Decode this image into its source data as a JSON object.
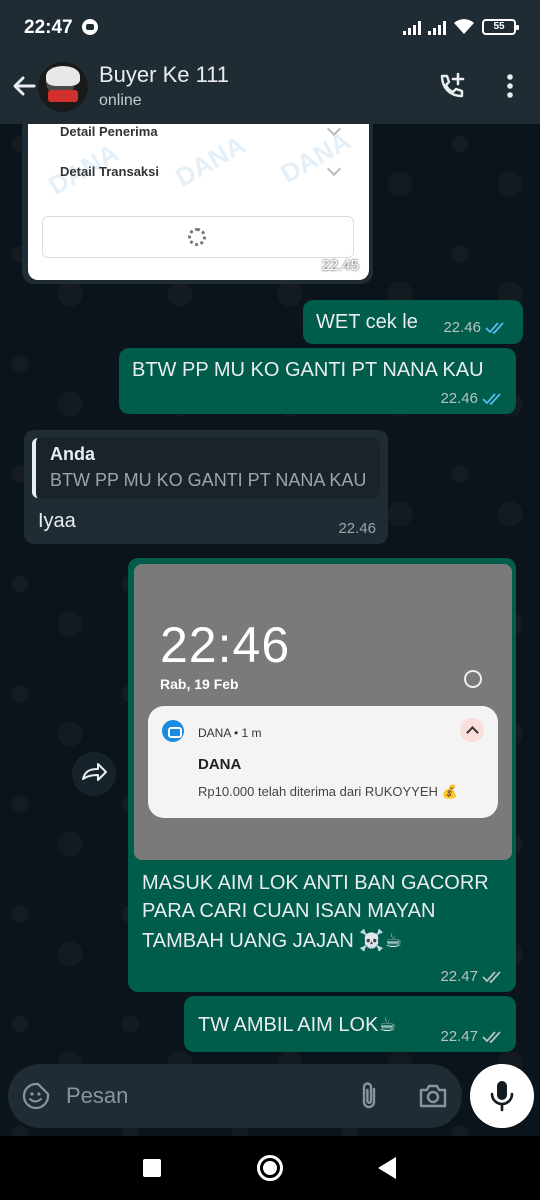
{
  "status_bar": {
    "time": "22:47",
    "battery": "55"
  },
  "header": {
    "name": "Buyer Ke 111",
    "status": "online"
  },
  "image_receipt": {
    "row1": "Detail Penerima",
    "row2": "Detail Transaksi",
    "watermark": "DANA",
    "time": "22.45"
  },
  "messages": {
    "m1": {
      "text": "WET cek le",
      "time": "22.46"
    },
    "m2": {
      "text": "BTW PP MU KO GANTI PT NANA KAU",
      "time": "22.46"
    },
    "m3": {
      "quote_name": "Anda",
      "quote_text": "BTW PP MU KO GANTI PT NANA KAU",
      "text": "Iyaa",
      "time": "22.46"
    },
    "m4": {
      "shot_clock": "22:46",
      "shot_date": "Rab, 19 Feb",
      "notif_app": "DANA • 1 m",
      "notif_title": "DANA",
      "notif_body": "Rp10.000 telah diterima dari RUKOYYEH 💰",
      "caption_line1": "MASUK AIM LOK ANTI BAN GACORR",
      "caption_line2": "PARA CARI CUAN ISAN MAYAN",
      "caption_line3": "TAMBAH UANG JAJAN ☠️☕",
      "time": "22.47"
    },
    "m5": {
      "text": "TW AMBIL AIM LOK☕",
      "time": "22.47"
    }
  },
  "composer": {
    "placeholder": "Pesan"
  },
  "colors": {
    "outgoing": "#005c4b",
    "incoming": "#202c33",
    "read_tick": "#53bdeb",
    "sent_tick": "#b5c4bf"
  }
}
